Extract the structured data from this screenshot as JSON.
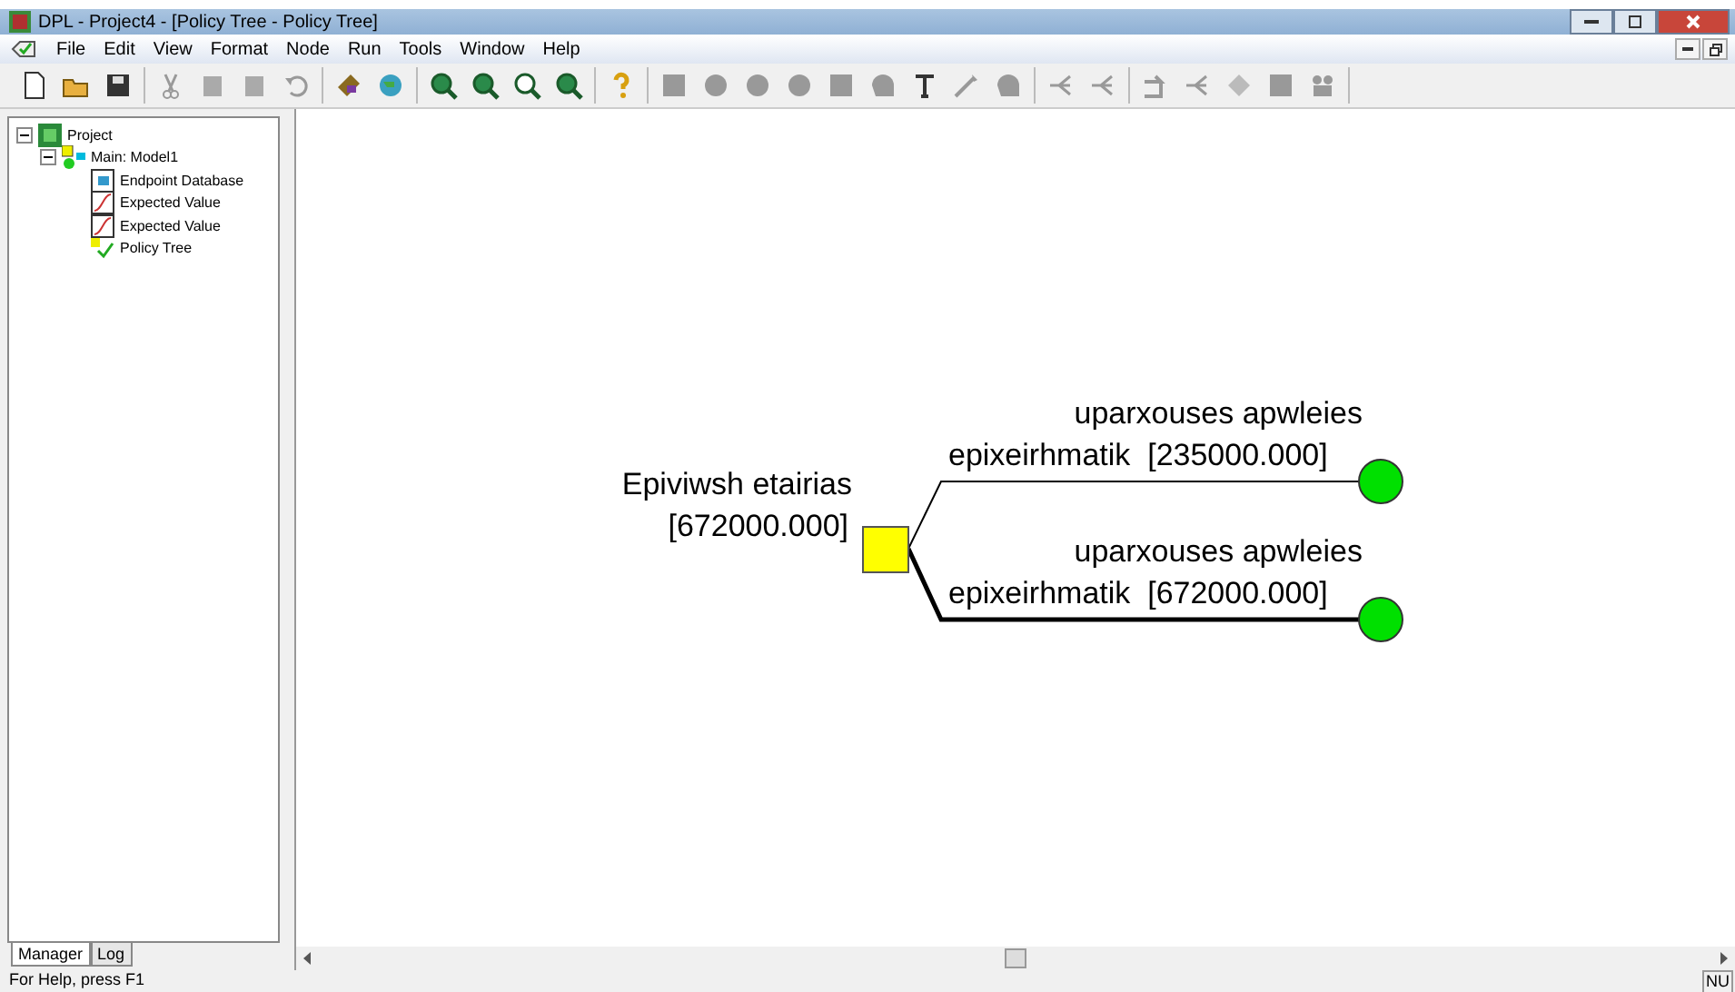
{
  "window": {
    "title": "DPL - Project4 - [Policy Tree - Policy Tree]"
  },
  "menu": [
    "File",
    "Edit",
    "View",
    "Format",
    "Node",
    "Run",
    "Tools",
    "Window",
    "Help"
  ],
  "tree": [
    {
      "label": "Project",
      "kind": "project",
      "expanded": true,
      "children": [
        {
          "label": "Main: Model1",
          "kind": "model",
          "expanded": true,
          "children": [
            {
              "label": "Endpoint Database",
              "kind": "database"
            },
            {
              "label": "Expected Value",
              "kind": "chart"
            },
            {
              "label": "Expected Value",
              "kind": "chart"
            },
            {
              "label": "Policy Tree",
              "kind": "policy"
            }
          ]
        }
      ]
    }
  ],
  "panel_tabs": [
    {
      "label": "Manager",
      "selected": true
    },
    {
      "label": "Log",
      "selected": false
    }
  ],
  "diagram": {
    "decision": {
      "name": "Epiviwsh etairias",
      "value": "[672000.000]"
    },
    "branches": [
      {
        "label": "uparxouses apwleies",
        "sublabel": "epixeirhmatik  [235000.000]",
        "optimal": false
      },
      {
        "label": "uparxouses apwleies",
        "sublabel": "epixeirhmatik  [672000.000]",
        "optimal": true
      }
    ]
  },
  "status_bar": {
    "text": "For Help, press F1",
    "indicator": "NU"
  }
}
